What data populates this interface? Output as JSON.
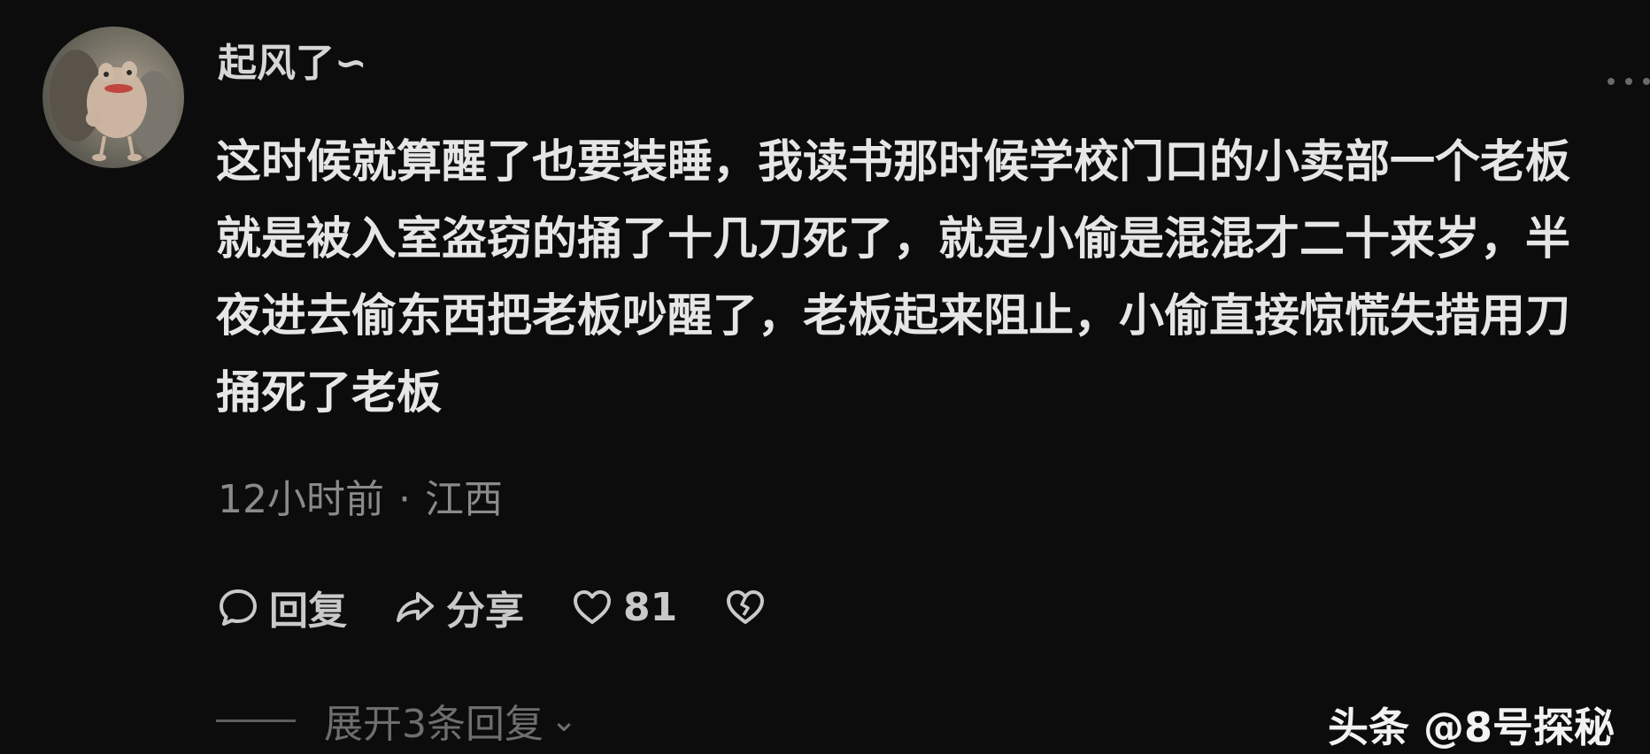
{
  "comment": {
    "username": "起风了∽",
    "avatar_icon": "frog-plush-avatar",
    "more_icon": "more-dots-icon",
    "text": "这时候就算醒了也要装睡，我读书那时候学校门口的小卖部一个老板就是被入室盗窃的捅了十几刀死了，就是小偷是混混才二十来岁，半夜进去偷东西把老板吵醒了，老板起来阻止，小偷直接惊慌失措用刀捅死了老板",
    "time": "12小时前",
    "separator": "·",
    "location": "江西"
  },
  "actions": {
    "reply": {
      "icon": "comment-bubble-icon",
      "label": "回复"
    },
    "share": {
      "icon": "share-arrow-icon",
      "label": "分享"
    },
    "like": {
      "icon": "heart-icon",
      "count": "81"
    },
    "dislike": {
      "icon": "broken-heart-icon"
    }
  },
  "expand_replies": {
    "label": "展开3条回复",
    "icon": "chevron-down-icon"
  },
  "watermark": {
    "text": "头条 @8号探秘"
  },
  "colors": {
    "background": "#0c0c0c",
    "text": "#e6e6e6",
    "meta": "#8a8a8a"
  }
}
